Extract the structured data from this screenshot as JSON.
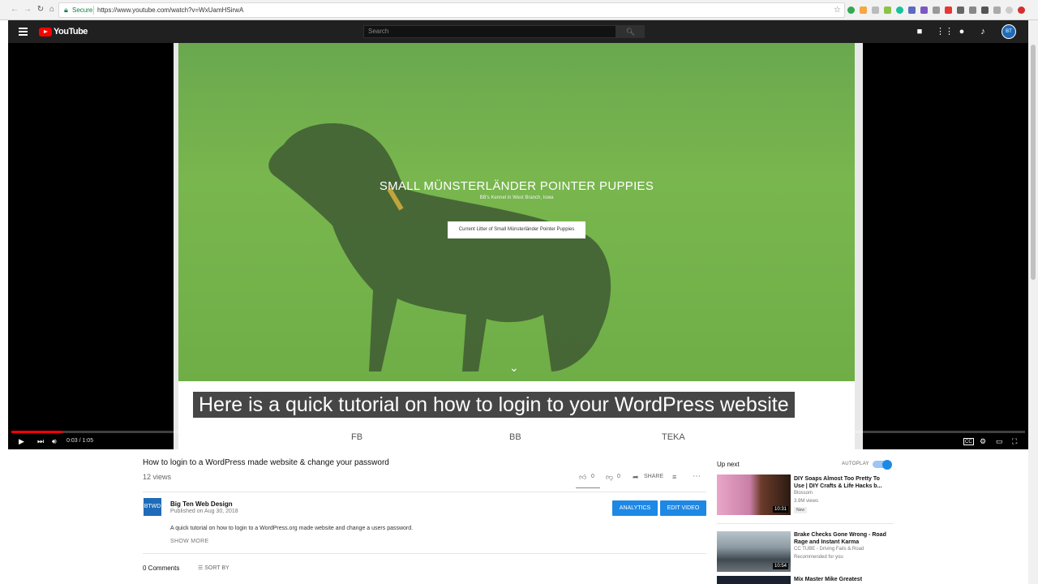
{
  "browser": {
    "secure_label": "Secure",
    "url": "https://www.youtube.com/watch?v=WxUamHSirwA"
  },
  "header": {
    "logo_text": "YouTube",
    "search_placeholder": "Search"
  },
  "player": {
    "site": {
      "title": "SMALL MÜNSTERLÄNDER POINTER PUPPIES",
      "subtitle": "BB's Kennel in West Branch, Iowa",
      "button": "Current Litter of Small Münsterländer Pointer Puppies",
      "footer_links": [
        "FB",
        "BB",
        "TEKA"
      ]
    },
    "caption": "Here is a quick tutorial on how to login to your WordPress website",
    "time": "0:03 / 1:05",
    "progress": 0.05,
    "cc_label": "CC"
  },
  "video": {
    "title": "How to login to a WordPress made website & change your password",
    "views": "12 views",
    "likes": "0",
    "dislikes": "0",
    "share_label": "SHARE"
  },
  "channel": {
    "logo_text": "BTWD",
    "name": "Big Ten Web Design",
    "published": "Published on Aug 30, 2018",
    "analytics_label": "ANALYTICS",
    "edit_label": "EDIT VIDEO"
  },
  "description": {
    "text": "A quick tutorial on how to login to a WordPress.org made website and change a users password.",
    "show_more": "SHOW MORE"
  },
  "comments": {
    "count": "0 Comments",
    "sort_label": "SORT BY"
  },
  "sidebar": {
    "up_next": "Up next",
    "autoplay": "AUTOPLAY",
    "items": [
      {
        "title": "DIY Soaps Almost Too Pretty To Use | DIY Crafts & Life Hacks b...",
        "channel": "Blossom",
        "views": "3.9M views",
        "badge": "New",
        "duration": "10:31"
      },
      {
        "title": "Brake Checks Gone Wrong - Road Rage and Instant Karma",
        "channel": "CC TUBE - Driving Fails & Road",
        "views": "Recommended for you",
        "duration": "10:54"
      },
      {
        "title": "Mix Master Mike Greatest"
      }
    ]
  }
}
